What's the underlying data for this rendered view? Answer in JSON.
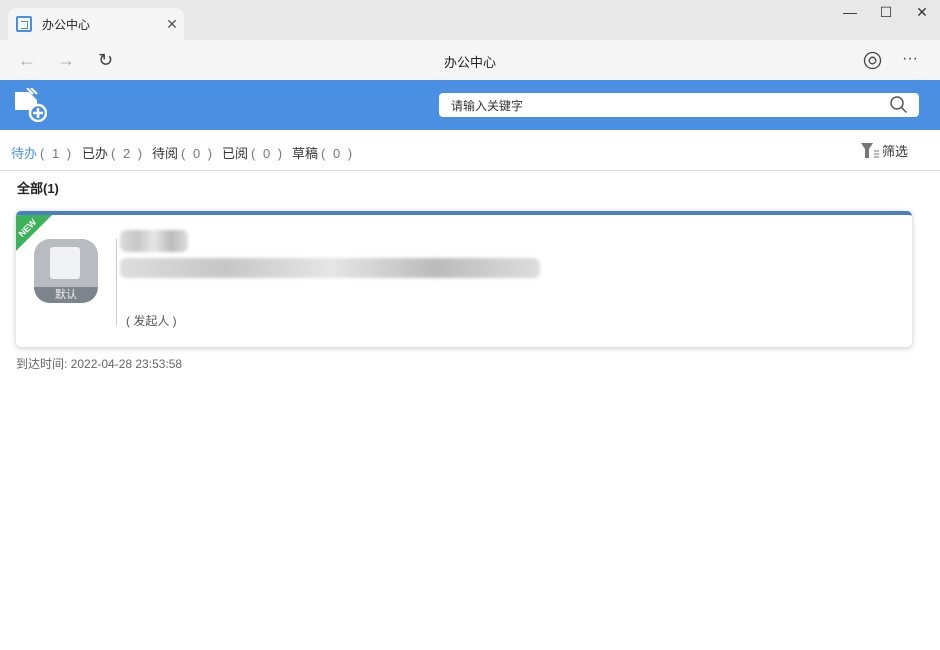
{
  "browser": {
    "tab_title": "办公中心",
    "page_title": "办公中心",
    "close": "✕",
    "minimize": "—",
    "maximize": "☐",
    "window_close": "✕",
    "back": "←",
    "forward": "→",
    "refresh": "↻",
    "more": "···"
  },
  "search": {
    "placeholder": "请输入关键字"
  },
  "tabs": [
    {
      "label": "待办",
      "count": "( 1 )"
    },
    {
      "label": "已办",
      "count": "( 2 )"
    },
    {
      "label": "待阅",
      "count": "( 0 )"
    },
    {
      "label": "已阅",
      "count": "( 0 )"
    },
    {
      "label": "草稿",
      "count": "( 0 )"
    }
  ],
  "filter_label": "筛选",
  "section_title": "全部(1)",
  "card": {
    "badge": "NEW",
    "icon_label": "默认",
    "initiator": "( 发起人 )",
    "arrival_time": "到达时间: 2022-04-28 23:53:58"
  },
  "colors": {
    "accent": "#4a90e2",
    "badge": "#3cb35a"
  }
}
